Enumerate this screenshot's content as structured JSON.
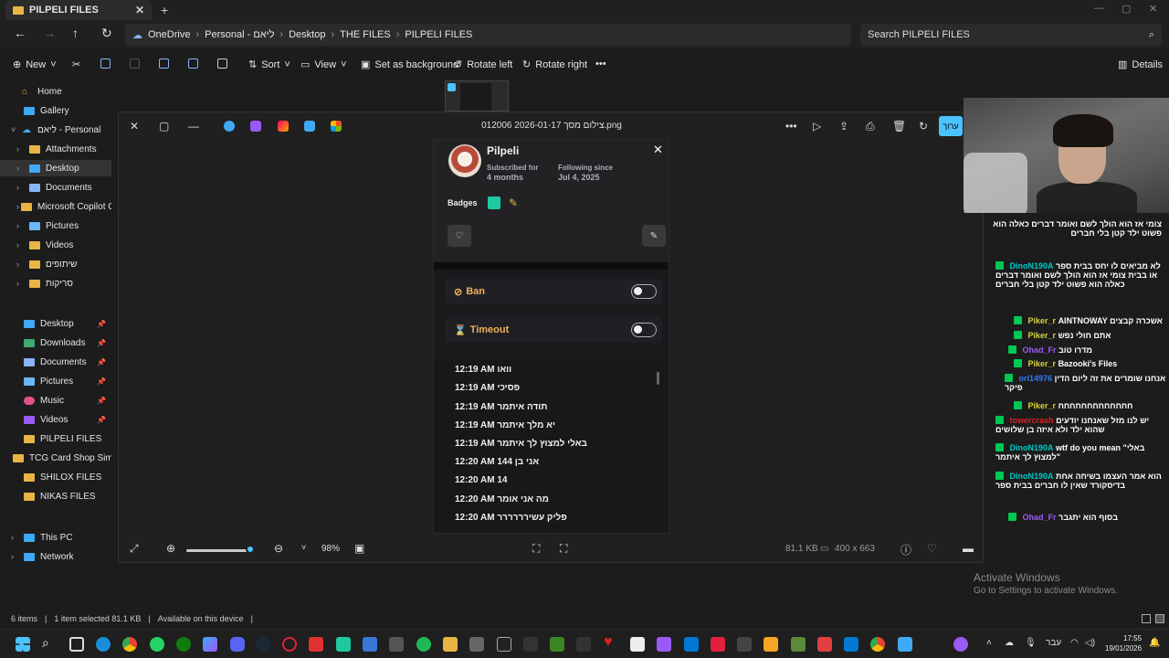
{
  "explorer": {
    "tab_title": "PILPELI FILES",
    "breadcrumb": [
      "OneDrive",
      "Personal - ליאם",
      "Desktop",
      "THE FILES",
      "PILPELI FILES"
    ],
    "search_placeholder": "Search PILPELI FILES",
    "commands": {
      "new": "New",
      "sort": "Sort",
      "view": "View",
      "set_bg": "Set as background",
      "rotate_left": "Rotate left",
      "rotate_right": "Rotate right",
      "details": "Details"
    },
    "nav": {
      "home": "Home",
      "gallery": "Gallery",
      "personal": "ליאם - Personal",
      "attachments": "Attachments",
      "desktop": "Desktop",
      "documents": "Documents",
      "copilot": "Microsoft Copilot Ch",
      "pictures": "Pictures",
      "videos": "Videos",
      "shared": "שיתופים",
      "scans": "סריקות",
      "q_desktop": "Desktop",
      "q_downloads": "Downloads",
      "q_documents": "Documents",
      "q_pictures": "Pictures",
      "q_music": "Music",
      "q_videos": "Videos",
      "q_pilpeli": "PILPELI FILES",
      "q_tcg": "TCG Card Shop Simula",
      "q_shilox": "SHILOX FILES",
      "q_nikas": "NIKAS FILES",
      "thispc": "This PC",
      "network": "Network"
    },
    "status": {
      "items": "6 items",
      "selected": "1 item selected  81.1 KB",
      "available": "Available on this device"
    }
  },
  "viewer": {
    "title": "צילום מסך 2026-01-17 012006.png",
    "edit_label": "ערוך",
    "zoom": "98%",
    "file_size": "81.1 KB",
    "dimensions": "400 x 663"
  },
  "twitch_card": {
    "username": "Pilpeli",
    "subscribed_label": "Subscribed for",
    "subscribed_value": "4 months",
    "following_label": "Following since",
    "following_value": "Jul 4, 2025",
    "badges_label": "Badges",
    "ban_label": "Ban",
    "timeout_label": "Timeout",
    "messages": [
      "12:19 AM וואו",
      "12:19 AM פסיכי",
      "12:19 AM תודה איתמר",
      "12:19 AM יא מלך איתמר",
      "12:19 AM באלי למצוץ לך איתמר",
      "12:20 AM אני בן 144",
      "12:20 AM 14",
      "12:20 AM מה אני אומר",
      "12:20 AM פליק עשירררררר"
    ]
  },
  "chat": [
    {
      "user": "",
      "text": "צומי אז הוא הולך לשם ואומר דברים כאלה הוא פשוט ילד קטן בלי חברים",
      "color": "#ffffff"
    },
    {
      "user": "DinoN190A",
      "text": "לא מביאים לו יחס בבית ספר או בבית צומי אז הוא הולך לשם ואומר דברים כאלה הוא פשוט ילד קטן בלי חברים",
      "color": "#00c8c8"
    },
    {
      "user": "Piker_r",
      "text": "AINTNOWAY אשכרה קבצים",
      "color": "#d6d23a"
    },
    {
      "user": "Piker_r",
      "text": "אתם חולי נפש",
      "color": "#d6d23a"
    },
    {
      "user": "Ohad_Fr",
      "text": "מדרו טוב",
      "color": "#9b59f5"
    },
    {
      "user": "Piker_r",
      "text": "Bazooki's Files",
      "color": "#d6d23a"
    },
    {
      "user": "ori14976",
      "text": "אנחנו שומרים את זה ליום הדין פיקר",
      "color": "#2f7bff"
    },
    {
      "user": "Piker_r",
      "text": "חחחחחחחחחחחחח",
      "color": "#d6d23a"
    },
    {
      "user": "towercrash",
      "text": "יש לנו מזל שאנחנו יודעים שהוא ילד ולא איזה בן שלושים",
      "color": "#e02020"
    },
    {
      "user": "DinoN190A",
      "text": "wtf do you mean \"באלי למצוץ לך איתמר\"",
      "color": "#00c8c8"
    },
    {
      "user": "DinoN190A",
      "text": "הוא אמר העצמו בשיחה אחת בדיסקורד שאין לו חברים בבית ספר",
      "color": "#00c8c8"
    },
    {
      "user": "Ohad_Fr",
      "text": "בסוף הוא יתגבר",
      "color": "#9b59f5"
    }
  ],
  "activate": {
    "title": "Activate Windows",
    "subtitle": "Go to Settings to activate Windows."
  },
  "taskbar": {
    "lang": "עבר",
    "time": "17:55",
    "date": "19/01/2026"
  }
}
